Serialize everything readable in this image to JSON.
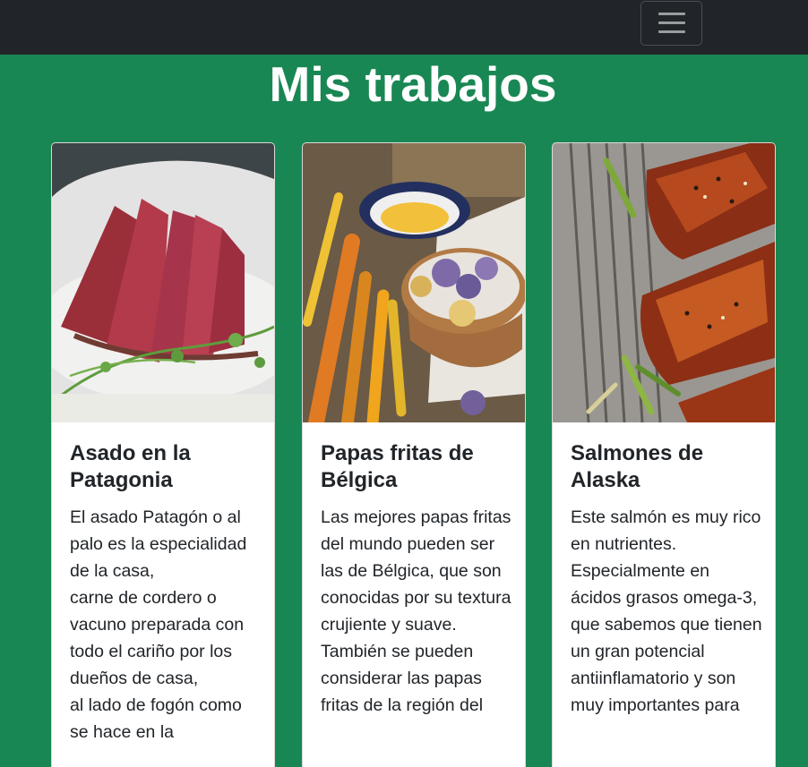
{
  "navbar": {
    "toggler_icon": "hamburger-menu-icon"
  },
  "section": {
    "title": "Mis trabajos"
  },
  "cards": [
    {
      "title": "Asado en la Patagonia",
      "text": "El asado Patagón o al palo es la especialidad de la casa,\ncarne de cordero o vacuno preparada con todo el cariño por los dueños de casa,\nal lado de fogón como se hace en la",
      "image": "sliced-seared-tuna-photo"
    },
    {
      "title": "Papas fritas de Bélgica",
      "text": "Las mejores papas fritas del mundo pueden ser las de Bélgica, que son conocidas por su textura crujiente y suave.\nTambién se pueden considerar las papas fritas de la región del",
      "image": "roasted-vegetables-and-chips-photo"
    },
    {
      "title": "Salmones de Alaska",
      "text": "Este salmón es muy rico en nutrientes. Especialmente en ácidos grasos omega-3,\nque sabemos que tienen un gran potencial antiinflamatorio y son muy importantes para",
      "image": "glazed-salmon-fillets-photo"
    }
  ],
  "colors": {
    "background": "#198754",
    "navbar": "#212529",
    "card": "#ffffff"
  }
}
